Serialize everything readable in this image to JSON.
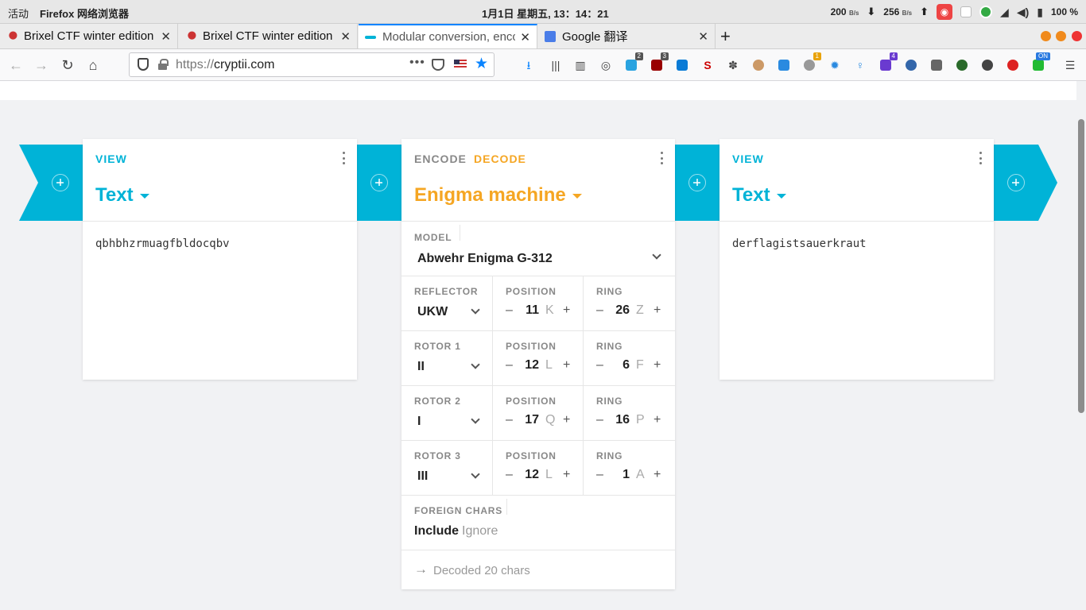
{
  "system_bar": {
    "activities": "活动",
    "app_name": "Firefox 网络浏览器",
    "clock": "1月1日 星期五, 13：14：21",
    "download_speed": "200",
    "upload_speed": "256",
    "speed_unit": "B/s",
    "battery": "100 %"
  },
  "tabs": [
    {
      "label": "Brixel CTF winter edition",
      "active": false
    },
    {
      "label": "Brixel CTF winter edition",
      "active": false
    },
    {
      "label": "Modular conversion, encoding and encryption",
      "active": true
    },
    {
      "label": "Google 翻译",
      "active": false
    }
  ],
  "url": {
    "scheme": "https://",
    "host": "cryptii.com"
  },
  "extension_badges": {
    "ext1": "2",
    "ext2": "3",
    "ext3": "1",
    "ext4": "4",
    "ext5": "ON"
  },
  "brick1": {
    "mode": "VIEW",
    "title": "Text",
    "content": "qbhbhzrmuagfbldocqbv"
  },
  "enigma": {
    "encode_label": "ENCODE",
    "decode_label": "DECODE",
    "title": "Enigma machine",
    "model_label": "MODEL",
    "model_value": "Abwehr Enigma G-312",
    "position_label": "POSITION",
    "ring_label": "RING",
    "rows": [
      {
        "label": "REFLECTOR",
        "value": "UKW",
        "position": "11",
        "position_letter": "K",
        "ring": "26",
        "ring_letter": "Z"
      },
      {
        "label": "ROTOR 1",
        "value": "II",
        "position": "12",
        "position_letter": "L",
        "ring": "6",
        "ring_letter": "F"
      },
      {
        "label": "ROTOR 2",
        "value": "I",
        "position": "17",
        "position_letter": "Q",
        "ring": "16",
        "ring_letter": "P"
      },
      {
        "label": "ROTOR 3",
        "value": "III",
        "position": "12",
        "position_letter": "L",
        "ring": "1",
        "ring_letter": "A"
      }
    ],
    "foreign_label": "FOREIGN CHARS",
    "foreign_include": "Include",
    "foreign_ignore": "Ignore",
    "status": "Decoded 20 chars"
  },
  "brick3": {
    "mode": "VIEW",
    "title": "Text",
    "content": "derflagistsauerkraut"
  },
  "colors": {
    "accent_cyan": "#00b3d7",
    "accent_orange": "#f5a623",
    "firefox_blue": "#0a84ff"
  }
}
